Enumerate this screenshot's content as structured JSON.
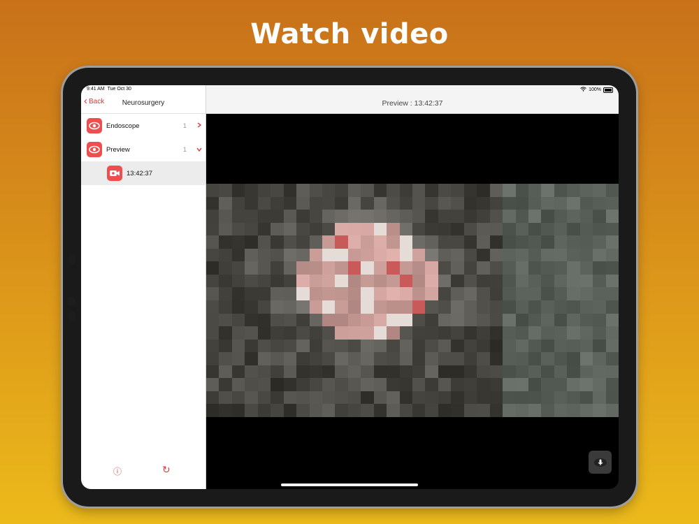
{
  "headline": "Watch video",
  "status": {
    "time": "9:41 AM",
    "date": "Tue Oct 30",
    "battery": "100%"
  },
  "sidebar": {
    "back_label": "Back",
    "title": "Neurosurgery",
    "items": [
      {
        "label": "Endoscope",
        "count": "1",
        "chevron": "›",
        "icon": "eye-icon"
      },
      {
        "label": "Preview",
        "count": "1",
        "chevron": "⌄",
        "icon": "eye-icon"
      },
      {
        "label": "13:42:37",
        "icon": "video-camera-icon"
      }
    ],
    "footer": {
      "info_icon": "ⓘ",
      "refresh_icon": "↻"
    }
  },
  "main": {
    "title": "Preview : 13:42:37"
  },
  "colors": {
    "accent": "#e5343a",
    "icon_bg": "#ee4e4e"
  }
}
